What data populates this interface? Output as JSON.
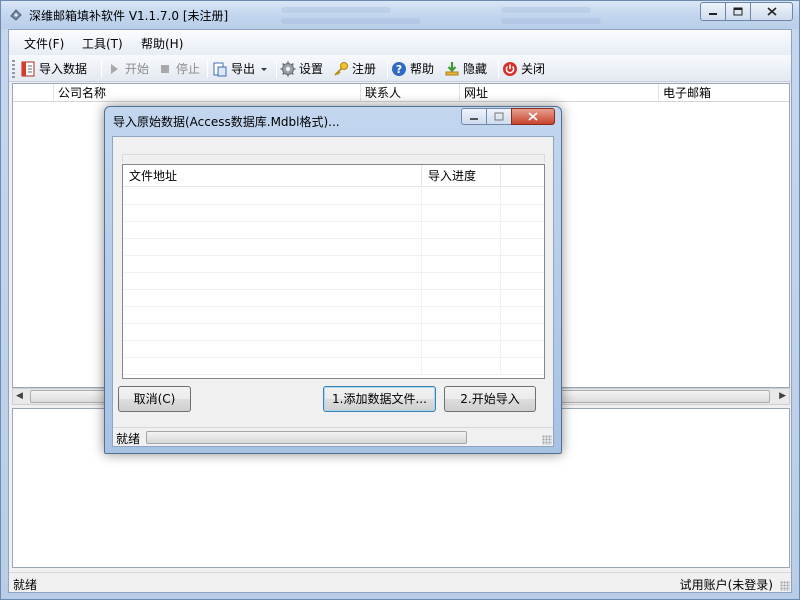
{
  "window": {
    "title": "深维邮箱填补软件 V1.1.7.0 [未注册]"
  },
  "menu": {
    "items": [
      "文件(F)",
      "工具(T)",
      "帮助(H)"
    ]
  },
  "toolbar": {
    "import_label": "导入数据",
    "start_label": "开始",
    "stop_label": "停止",
    "export_label": "导出",
    "settings_label": "设置",
    "register_label": "注册",
    "help_label": "帮助",
    "hide_label": "隐藏",
    "close_label": "关闭"
  },
  "grid": {
    "columns": [
      "公司名称",
      "联系人",
      "网址",
      "电子邮箱"
    ]
  },
  "statusbar": {
    "left": "就绪",
    "right": "试用账户(未登录)"
  },
  "dialog": {
    "title": "导入原始数据(Access数据库.Mdbl格式)...",
    "columns": [
      "文件地址",
      "导入进度"
    ],
    "cancel_label": "取消(C)",
    "add_files_label": "1.添加数据文件...",
    "start_import_label": "2.开始导入",
    "status": "就绪",
    "progress": 0
  }
}
